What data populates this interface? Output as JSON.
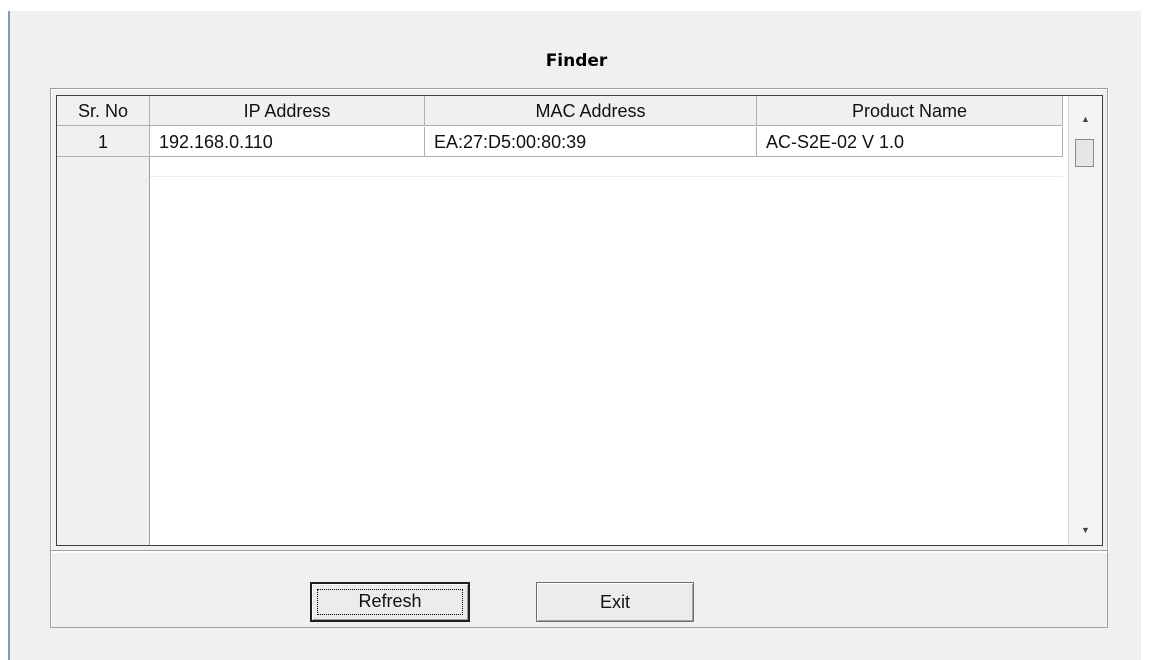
{
  "window": {
    "title": "Finder"
  },
  "table": {
    "columns": [
      "Sr. No",
      "IP Address",
      "MAC Address",
      "Product Name"
    ],
    "rows": [
      {
        "sr_no": "1",
        "ip_address": "192.168.0.110",
        "mac_address": "EA:27:D5:00:80:39",
        "product_name": "AC-S2E-02 V 1.0"
      }
    ]
  },
  "scrollbar": {
    "up_icon": "arrow-up-icon",
    "down_icon": "arrow-down-icon"
  },
  "buttons": {
    "refresh_label": "Refresh",
    "exit_label": "Exit"
  },
  "colors": {
    "window_bg": "#f0f0f0",
    "grid_bg": "#ffffff",
    "window_border": "#7f9db9"
  }
}
